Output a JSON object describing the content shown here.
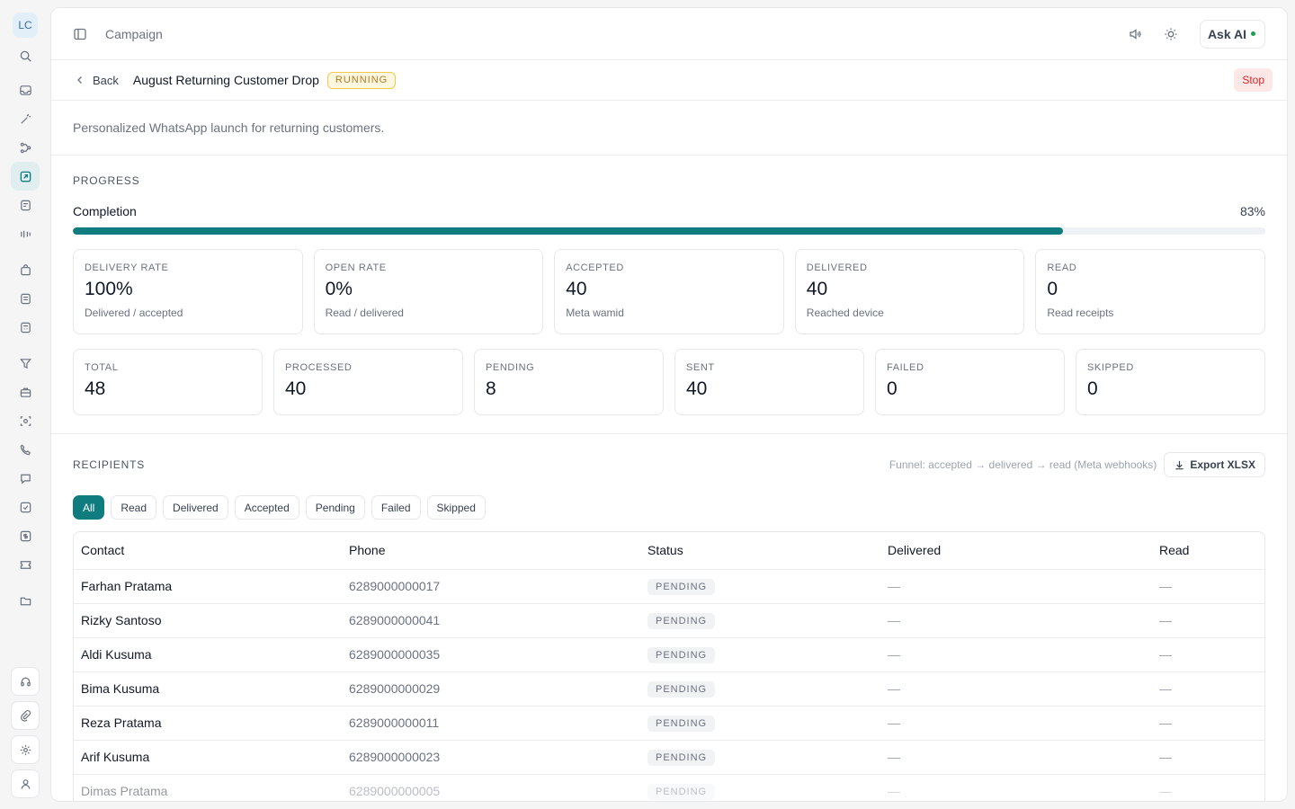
{
  "user": {
    "initials": "LC"
  },
  "topbar": {
    "breadcrumb": "Campaign",
    "ask_ai_label": "Ask AI"
  },
  "campaign": {
    "back_label": "Back",
    "title": "August Returning Customer Drop",
    "status": "RUNNING",
    "stop_label": "Stop",
    "description": "Personalized WhatsApp launch for returning customers."
  },
  "progress": {
    "section_label": "PROGRESS",
    "completion_label": "Completion",
    "completion_text": "83%",
    "completion_value": 0.83,
    "rate_cards": [
      {
        "label": "DELIVERY RATE",
        "value": "100%",
        "sub": "Delivered / accepted"
      },
      {
        "label": "OPEN RATE",
        "value": "0%",
        "sub": "Read / delivered"
      },
      {
        "label": "ACCEPTED",
        "value": "40",
        "sub": "Meta wamid"
      },
      {
        "label": "DELIVERED",
        "value": "40",
        "sub": "Reached device"
      },
      {
        "label": "READ",
        "value": "0",
        "sub": "Read receipts"
      }
    ],
    "count_cards": [
      {
        "label": "TOTAL",
        "value": "48"
      },
      {
        "label": "PROCESSED",
        "value": "40"
      },
      {
        "label": "PENDING",
        "value": "8"
      },
      {
        "label": "SENT",
        "value": "40"
      },
      {
        "label": "FAILED",
        "value": "0"
      },
      {
        "label": "SKIPPED",
        "value": "0"
      }
    ]
  },
  "recipients": {
    "section_label": "RECIPIENTS",
    "funnel_note": "Funnel: accepted → delivered → read (Meta webhooks)",
    "export_label": "Export XLSX",
    "filters": [
      "All",
      "Read",
      "Delivered",
      "Accepted",
      "Pending",
      "Failed",
      "Skipped"
    ],
    "active_filter": "All",
    "columns": [
      "Contact",
      "Phone",
      "Status",
      "Delivered",
      "Read"
    ],
    "rows": [
      {
        "contact": "Farhan Pratama",
        "phone": "6289000000017",
        "status": "PENDING",
        "delivered": "—",
        "read": "—"
      },
      {
        "contact": "Rizky Santoso",
        "phone": "6289000000041",
        "status": "PENDING",
        "delivered": "—",
        "read": "—"
      },
      {
        "contact": "Aldi Kusuma",
        "phone": "6289000000035",
        "status": "PENDING",
        "delivered": "—",
        "read": "—"
      },
      {
        "contact": "Bima Kusuma",
        "phone": "6289000000029",
        "status": "PENDING",
        "delivered": "—",
        "read": "—"
      },
      {
        "contact": "Reza Pratama",
        "phone": "6289000000011",
        "status": "PENDING",
        "delivered": "—",
        "read": "—"
      },
      {
        "contact": "Arif Kusuma",
        "phone": "6289000000023",
        "status": "PENDING",
        "delivered": "—",
        "read": "—"
      },
      {
        "contact": "Dimas Pratama",
        "phone": "6289000000005",
        "status": "PENDING",
        "delivered": "—",
        "read": "—"
      }
    ]
  },
  "colors": {
    "accent": "#0f7c80",
    "running": "#b7791f",
    "stop": "#dc2626"
  }
}
